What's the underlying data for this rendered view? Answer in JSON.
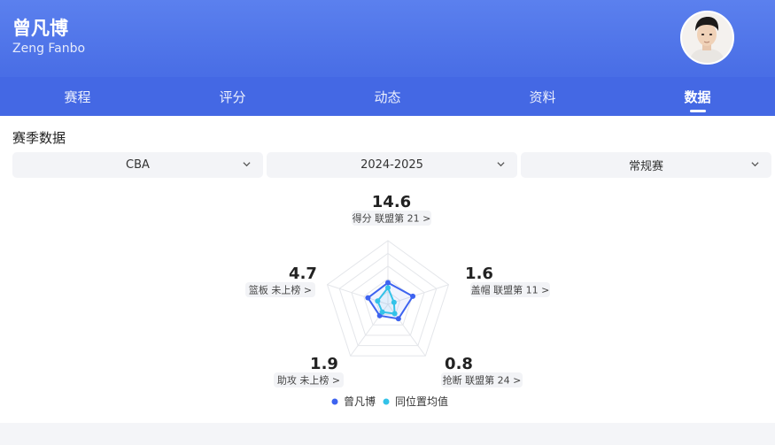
{
  "player": {
    "name_cn": "曾凡博",
    "name_en": "Zeng Fanbo"
  },
  "tabs": [
    {
      "label": "赛程",
      "active": false
    },
    {
      "label": "评分",
      "active": false
    },
    {
      "label": "动态",
      "active": false
    },
    {
      "label": "资料",
      "active": false
    },
    {
      "label": "数据",
      "active": true
    }
  ],
  "section": {
    "title": "赛季数据"
  },
  "filters": {
    "league": "CBA",
    "season": "2024-2025",
    "stage": "常规赛"
  },
  "colors": {
    "player": "#3d63f0",
    "average": "#33c2e8",
    "header": "#4a6fe6"
  },
  "icons": {
    "dropdown": "chevron-down-icon",
    "avatar": "player-photo"
  },
  "chart_data": {
    "type": "radar",
    "axes": [
      {
        "key": "points",
        "value": "14.6",
        "label": "得分 联盟第 21 >"
      },
      {
        "key": "blocks",
        "value": "1.6",
        "label": "盖帽 联盟第 11 >"
      },
      {
        "key": "steals",
        "value": "0.8",
        "label": "抢断 联盟第 24 >"
      },
      {
        "key": "assists",
        "value": "1.9",
        "label": "助攻 未上榜 >"
      },
      {
        "key": "rebounds",
        "value": "4.7",
        "label": "篮板 未上榜 >"
      }
    ],
    "series": [
      {
        "name": "曾凡博",
        "values": [
          0.34,
          0.41,
          0.28,
          0.22,
          0.33
        ]
      },
      {
        "name": "同位置均值",
        "values": [
          0.26,
          0.1,
          0.18,
          0.15,
          0.17
        ]
      }
    ],
    "rings": 5,
    "legend": "bottom-center"
  }
}
